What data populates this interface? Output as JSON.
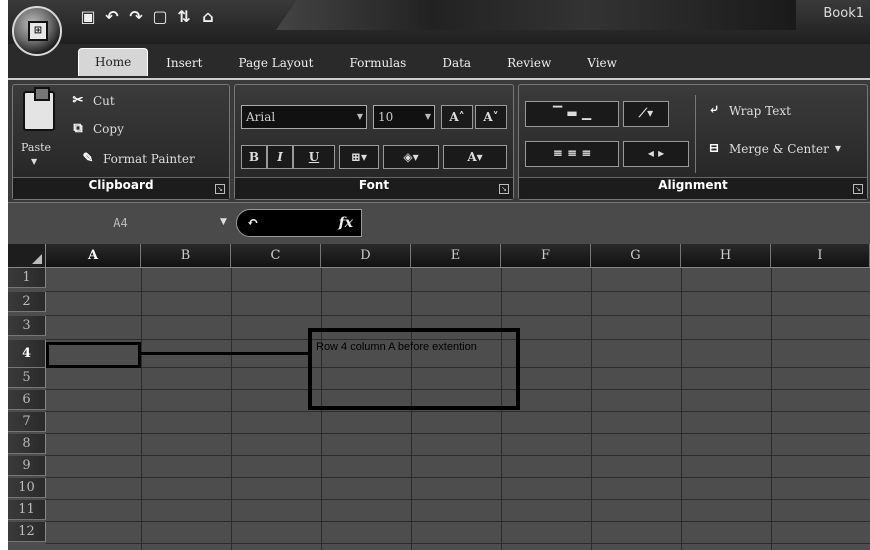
{
  "window": {
    "title": "Book1"
  },
  "office_button": {
    "logo": "Office"
  },
  "quick_access": {
    "icons": [
      "save-icon",
      "undo-icon",
      "redo-icon",
      "new-icon",
      "sort-icon",
      "open-icon"
    ]
  },
  "tabs": [
    "Home",
    "Insert",
    "Page Layout",
    "Formulas",
    "Data",
    "Review",
    "View"
  ],
  "active_tab": "Home",
  "clipboard": {
    "label": "Clipboard",
    "paste": "Paste",
    "cut": "Cut",
    "copy": "Copy",
    "format_painter": "Format Painter"
  },
  "font": {
    "label": "Font",
    "font_name": "Arial",
    "font_size": "10",
    "grow": "A˄",
    "shrink": "A˅",
    "bold": "B",
    "italic": "I",
    "underline": "U"
  },
  "alignment": {
    "label": "Alignment",
    "wrap_text": "Wrap Text",
    "merge_center": "Merge & Center"
  },
  "formula_bar": {
    "name_box": "A4",
    "fx": "fx"
  },
  "columns": [
    "A",
    "B",
    "C",
    "D",
    "E",
    "F",
    "G",
    "H",
    "I"
  ],
  "rows": [
    "1",
    "2",
    "3",
    "4",
    "5",
    "6",
    "7",
    "8",
    "9",
    "10",
    "11",
    "12"
  ],
  "selected_cell": {
    "column": "A",
    "row": "4"
  },
  "callout": {
    "text": "Row 4 column A before extention"
  }
}
